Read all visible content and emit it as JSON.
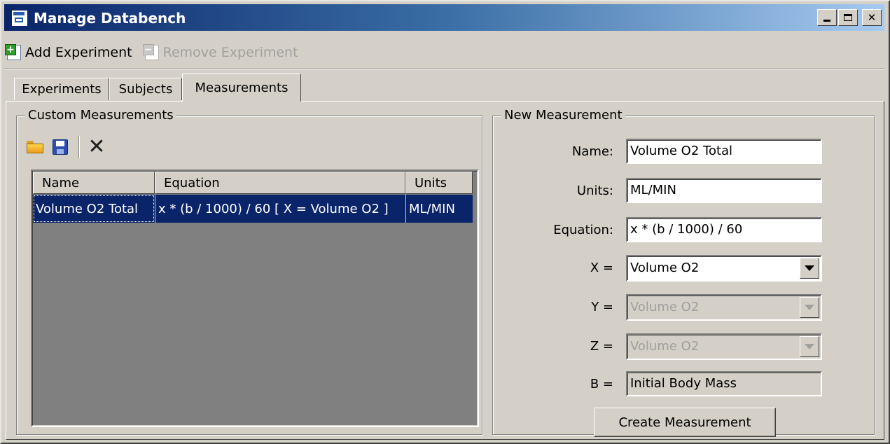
{
  "window": {
    "title": "Manage Databench"
  },
  "toolbar": {
    "add_label": "Add Experiment",
    "remove_label": "Remove Experiment"
  },
  "tabs": [
    {
      "label": "Experiments"
    },
    {
      "label": "Subjects"
    },
    {
      "label": "Measurements",
      "active": true
    }
  ],
  "custom": {
    "legend": "Custom Measurements",
    "columns": [
      "Name",
      "Equation",
      "Units"
    ],
    "rows": [
      {
        "name": "Volume O2 Total",
        "equation": "x * (b / 1000) / 60 [ X = Volume O2 ]",
        "units": "ML/MIN"
      }
    ]
  },
  "form": {
    "legend": "New Measurement",
    "name_label": "Name:",
    "name_value": "Volume O2 Total",
    "units_label": "Units:",
    "units_value": "ML/MIN",
    "equation_label": "Equation:",
    "equation_value": "x * (b / 1000) / 60",
    "x_label": "X =",
    "x_value": "Volume O2",
    "y_label": "Y =",
    "y_value": "Volume O2",
    "z_label": "Z =",
    "z_value": "Volume O2",
    "b_label": "B =",
    "b_value": "Initial Body Mass",
    "create_label": "Create Measurement"
  },
  "colors": {
    "titlebar_start": "#0a246a",
    "titlebar_end": "#a6caf0",
    "selection": "#0a246a",
    "face": "#d4d0c8"
  }
}
